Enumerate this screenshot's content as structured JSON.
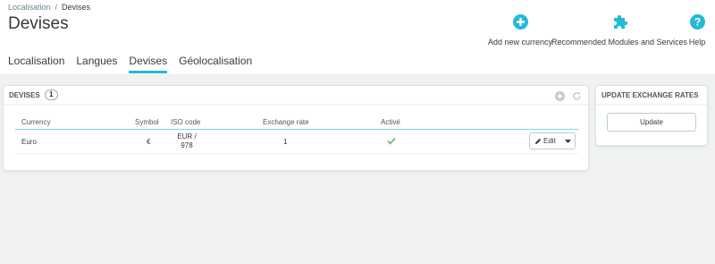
{
  "breadcrumb": {
    "parent": "Localisation",
    "separator": "/",
    "current": "Devises"
  },
  "page_title": "Devises",
  "toolbar": {
    "add_new_currency": "Add new currency",
    "recommended_modules": "Recommended Modules and Services",
    "help": "Help"
  },
  "tabs": [
    {
      "label": "Localisation",
      "active": false
    },
    {
      "label": "Langues",
      "active": false
    },
    {
      "label": "Devises",
      "active": true
    },
    {
      "label": "Géolocalisation",
      "active": false
    }
  ],
  "currencies_panel": {
    "title": "Devises",
    "count": "1",
    "columns": [
      "Currency",
      "Symbol",
      "ISO code",
      "Exchange rate",
      "Activé"
    ],
    "rows": [
      {
        "currency": "Euro",
        "symbol": "€",
        "iso_line1": "EUR /",
        "iso_line2": "978",
        "exchange_rate": "1",
        "active": true,
        "edit_label": "Edit"
      }
    ]
  },
  "exchange_panel": {
    "title": "Update exchange rates",
    "button": "Update"
  },
  "colors": {
    "accent": "#25b9d7",
    "success": "#70b580",
    "text": "#363a41",
    "background": "#eff1f2"
  },
  "icons": [
    "plus-circle-icon",
    "puzzle-icon",
    "help-circle-icon",
    "add-icon",
    "refresh-icon",
    "check-icon",
    "pencil-icon",
    "caret-down-icon"
  ]
}
